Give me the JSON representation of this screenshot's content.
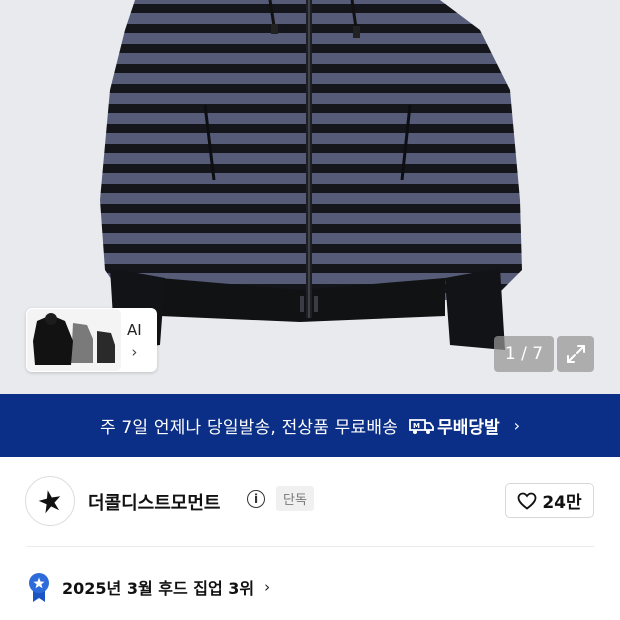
{
  "gallery": {
    "thumb_ai_label": "AI",
    "thumb_chevron": "›",
    "counter": "1 / 7",
    "expand_icon": "expand-icon"
  },
  "promo": {
    "text": "주 7일 언제나 당일발송, 전상품 무료배송",
    "badge": "무배당발",
    "chevron": "›",
    "bg_color": "#0b2f86"
  },
  "store": {
    "name": "더콜디스트모먼트",
    "info": "i",
    "badge": "단독",
    "likes": "24만"
  },
  "ranking": {
    "text": "2025년 3월 후드 집업 3위",
    "chevron": "›",
    "badge_color": "#2c6bd9"
  }
}
